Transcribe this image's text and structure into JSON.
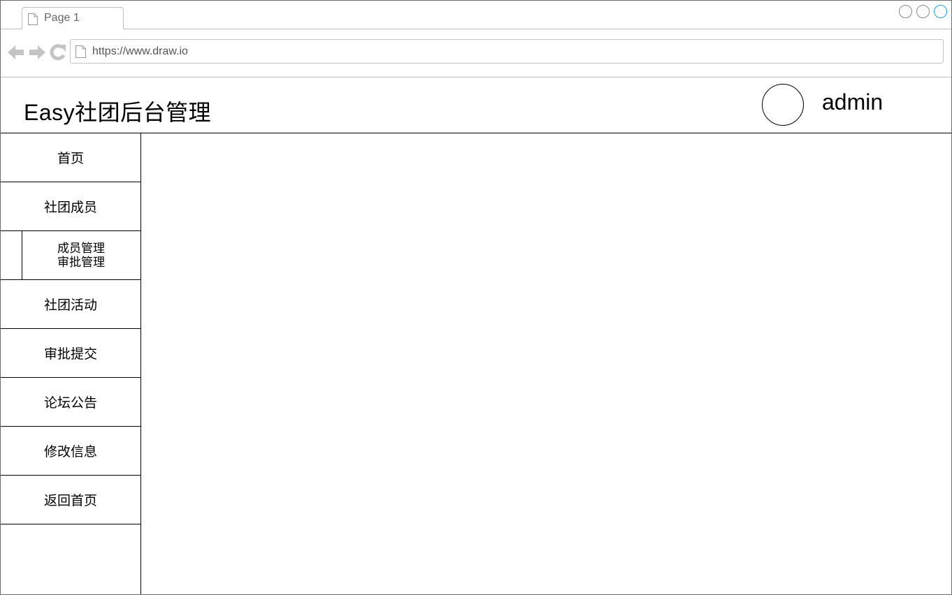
{
  "browser": {
    "tab_label": "Page 1",
    "url": "https://www.draw.io",
    "accent_color": "#1ba1e2"
  },
  "header": {
    "title": "Easy社团后台管理",
    "user_name": "admin"
  },
  "sidebar": {
    "items": [
      {
        "label": "首页"
      },
      {
        "label": "社团成员"
      },
      {
        "label": "社团活动"
      },
      {
        "label": "审批提交"
      },
      {
        "label": "论坛公告"
      },
      {
        "label": "修改信息"
      },
      {
        "label": "返回首页"
      }
    ],
    "sub_items": [
      {
        "label": "成员管理"
      },
      {
        "label": "审批管理"
      }
    ]
  }
}
